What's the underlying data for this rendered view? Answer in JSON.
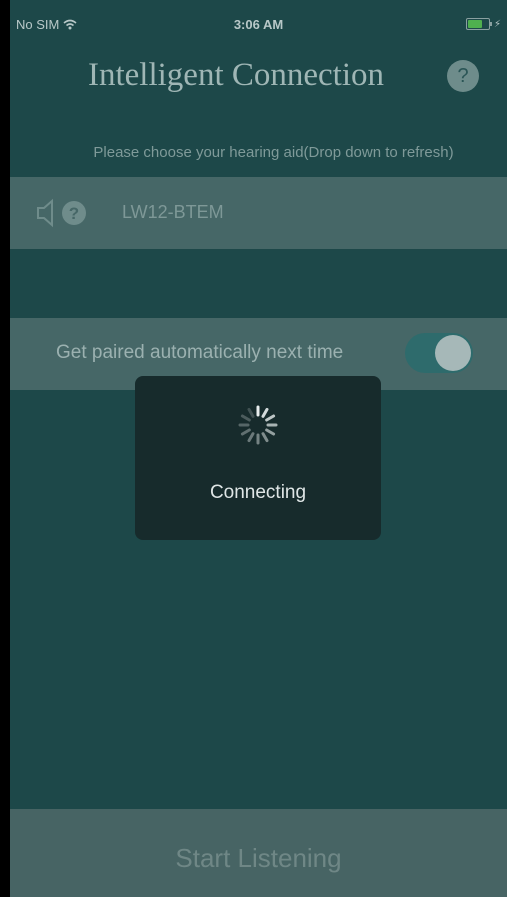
{
  "status_bar": {
    "carrier": "No SIM",
    "time": "3:06 AM",
    "wifi_icon": "wifi-icon",
    "battery_icon": "battery-charging-icon",
    "battery_color": "#4fb04f"
  },
  "header": {
    "title": "Intelligent Connection",
    "help_label": "?"
  },
  "hint": "Please choose your hearing aid(Drop down to refresh)",
  "device": {
    "icon": "hearing-aid-unknown-icon",
    "name": "LW12-BTEM"
  },
  "auto_pair": {
    "label": "Get paired automatically next time",
    "enabled": true
  },
  "hud": {
    "icon": "activity-spinner-icon",
    "label": "Connecting"
  },
  "start_button": {
    "label": "Start Listening"
  },
  "colors": {
    "background": "#1d4849",
    "row": "#466767",
    "hud": "#172b2c"
  }
}
